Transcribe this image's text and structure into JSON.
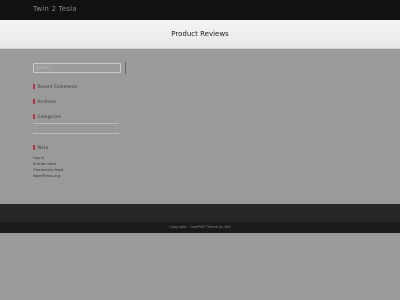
{
  "site": {
    "title": "Twin 2 Tesla"
  },
  "page": {
    "title": "Product Reviews"
  },
  "sidebar": {
    "search": {
      "placeholder": "Search"
    },
    "widgets": [
      {
        "label": "Recent Comments"
      },
      {
        "label": "Archives"
      },
      {
        "label": "Categories"
      },
      {
        "label": "Meta"
      }
    ],
    "meta_links": [
      "Log in",
      "Entries feed",
      "Comments feed",
      "WordPress.org"
    ]
  },
  "footer": {
    "copyright": "Copyright - OnePWP Theme by Ibili"
  },
  "colors": {
    "accent": "#b0344a",
    "topbar": "#111111",
    "body_bg": "#9a9a9a",
    "footer": "#262626"
  }
}
